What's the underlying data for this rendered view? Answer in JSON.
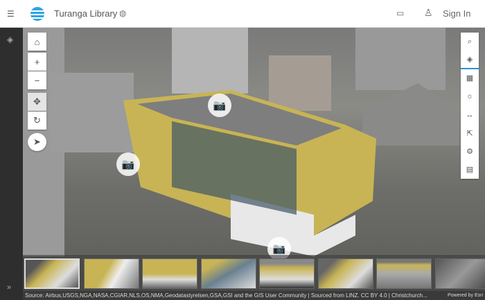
{
  "header": {
    "title": "Turanga Library",
    "sign_in": "Sign In",
    "icons": [
      "menu-icon",
      "globe-icon",
      "present-icon",
      "user-icon"
    ]
  },
  "colors": {
    "accent": "#2a8fd6",
    "logo": "#2ea3e6",
    "building": "#c8b455"
  },
  "left_tools": [
    {
      "name": "home",
      "glyph": "⌂"
    },
    {
      "name": "zoom-in",
      "glyph": "+"
    },
    {
      "name": "zoom-out",
      "glyph": "−"
    },
    {
      "name": "pan",
      "glyph": "✥"
    },
    {
      "name": "rotate",
      "glyph": "↻"
    },
    {
      "name": "compass",
      "glyph": "➤"
    }
  ],
  "right_tools": [
    {
      "name": "search",
      "glyph": "⌕"
    },
    {
      "name": "layers",
      "glyph": "◈",
      "active": true
    },
    {
      "name": "basemap",
      "glyph": "▦"
    },
    {
      "name": "daylight",
      "glyph": "☼"
    },
    {
      "name": "measure",
      "glyph": "↔"
    },
    {
      "name": "share",
      "glyph": "⇱"
    },
    {
      "name": "settings",
      "glyph": "⚙"
    },
    {
      "name": "slices",
      "glyph": "▤"
    }
  ],
  "slides": {
    "count": 8,
    "selected": 0
  },
  "attribution": "Source: Airbus,USGS,NGA,NASA,CGIAR,NLS,OS,NMA,Geodatastyrelsen,GSA,GSI and the GIS User Community | Sourced from LINZ. CC BY 4.0 | Christchurch...",
  "powered_by": "Powered by Esri"
}
